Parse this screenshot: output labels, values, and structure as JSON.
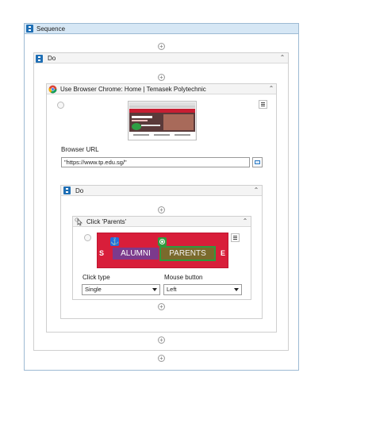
{
  "sequence": {
    "title": "Sequence"
  },
  "do_outer": {
    "title": "Do"
  },
  "browser": {
    "title": "Use Browser Chrome: Home | Temasek Polytechnic",
    "url_label": "Browser URL",
    "url_value": "\"https://www.tp.edu.sg/\""
  },
  "do_inner": {
    "title": "Do"
  },
  "click": {
    "title": "Click 'Parents'",
    "preview": {
      "left_letter": "S",
      "alumni": "ALUMNI",
      "parents": "PARENTS",
      "right_letter": "E"
    },
    "click_type_label": "Click type",
    "click_type_value": "Single",
    "mouse_button_label": "Mouse button",
    "mouse_button_value": "Left"
  },
  "colors": {
    "accent": "#1f6fb5",
    "header_bg": "#d6e7f5",
    "preview_red": "#d81e3a",
    "anchor_blue": "#1f6fe0",
    "target_green": "#2e9a3d"
  },
  "icons": [
    "sequence-icon",
    "collapse-icon",
    "add-activity-icon",
    "chrome-icon",
    "target-icon",
    "menu-icon",
    "click-icon",
    "anchor-icon",
    "browse-icon",
    "dropdown-arrow-icon"
  ]
}
